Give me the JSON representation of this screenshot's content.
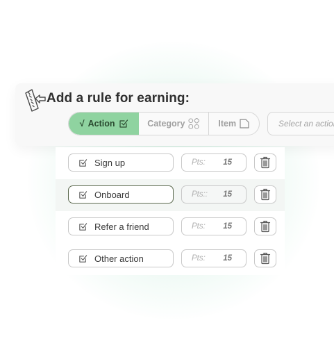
{
  "title": "Add a rule for earning:",
  "tabs": [
    {
      "label": "Action",
      "check": "√",
      "active": true,
      "icon": "checkbox-icon"
    },
    {
      "label": "Category",
      "active": false,
      "icon": "grid-icon"
    },
    {
      "label": "Item",
      "active": false,
      "icon": "square-icon"
    }
  ],
  "select": {
    "placeholder": "Select an action"
  },
  "rules": [
    {
      "action": "Sign up",
      "pts_label": "Pts:",
      "points": "15"
    },
    {
      "action": "Onboard",
      "pts_label": "Pts::",
      "points": "15"
    },
    {
      "action": "Refer a friend",
      "pts_label": "Pts:",
      "points": "15"
    },
    {
      "action": "Other action",
      "pts_label": "Pts:",
      "points": "15"
    }
  ],
  "colors": {
    "accent": "#8fd3a0",
    "text": "#2f2f2f",
    "muted": "#a0a0a0"
  }
}
